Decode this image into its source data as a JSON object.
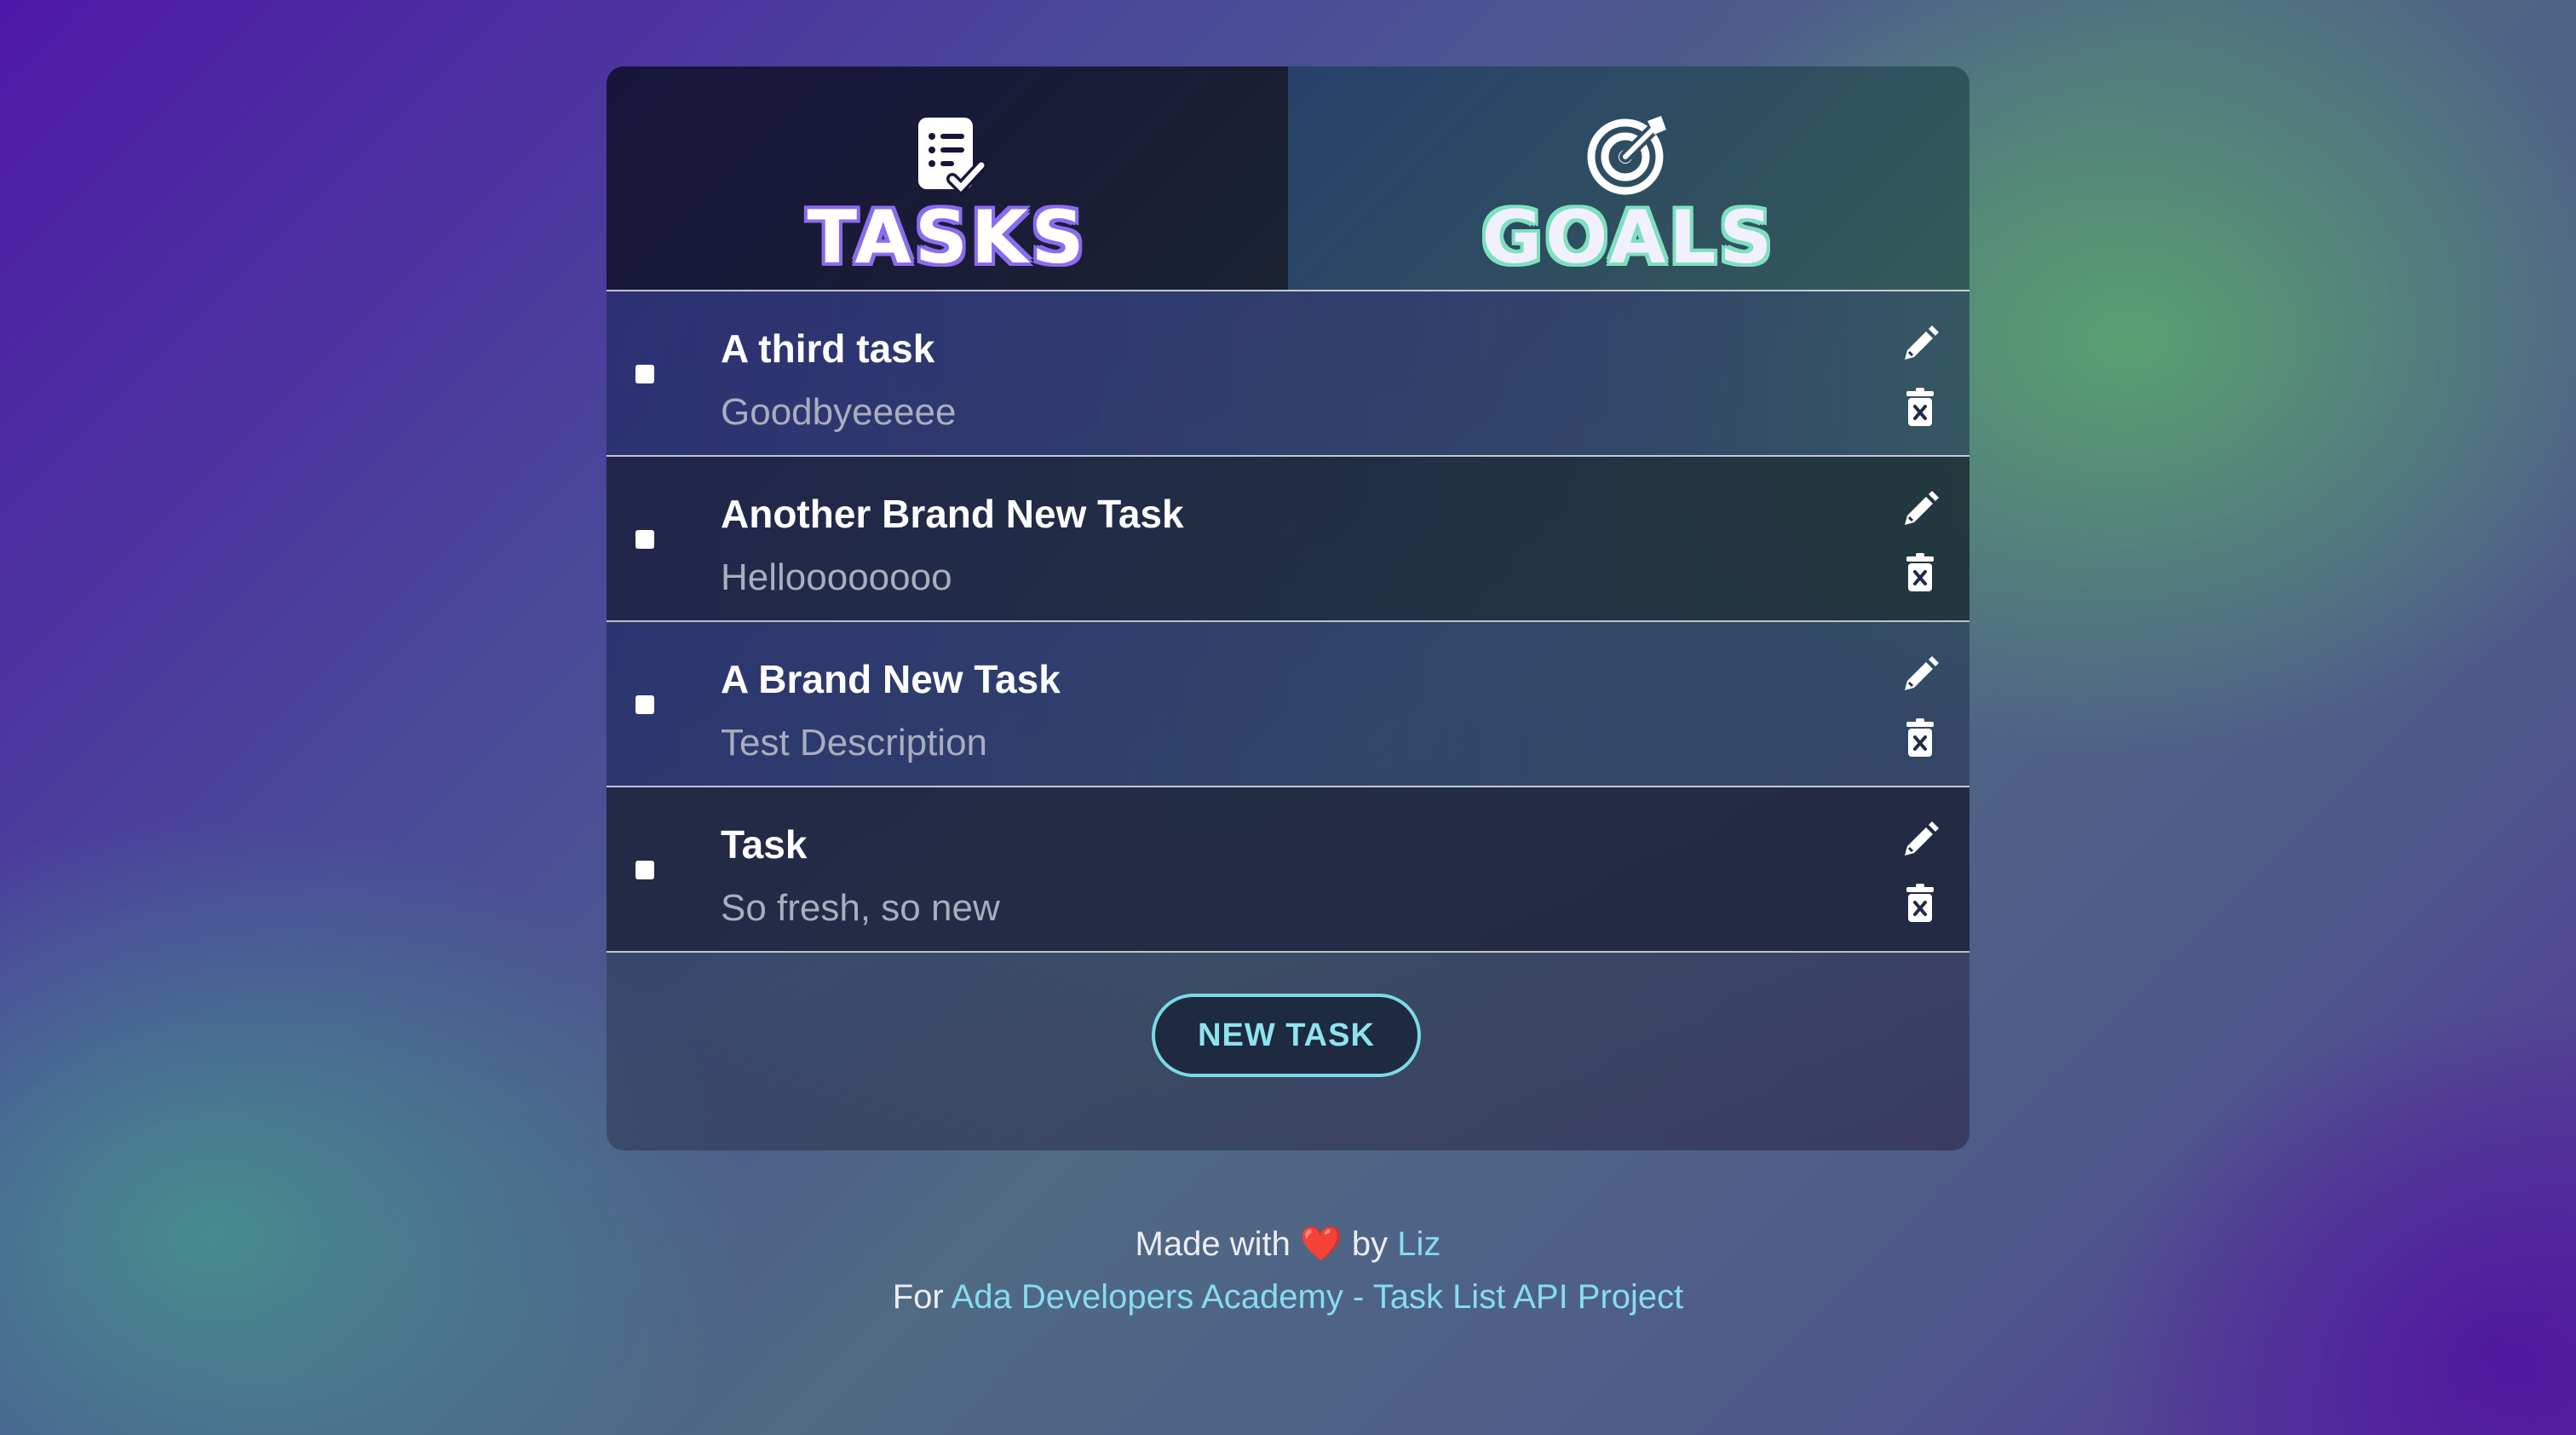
{
  "tabs": [
    {
      "label": "TASKS",
      "icon": "clipboard-check-icon",
      "active": true
    },
    {
      "label": "GOALS",
      "icon": "target-arrow-icon",
      "active": false
    }
  ],
  "tasks": [
    {
      "title": "A third task",
      "description": "Goodbyeeeee",
      "completed": false
    },
    {
      "title": "Another Brand New Task",
      "description": "Helloooooooo",
      "completed": false
    },
    {
      "title": "A Brand New Task",
      "description": "Test Description",
      "completed": false
    },
    {
      "title": "Task",
      "description": "So fresh, so new",
      "completed": false
    }
  ],
  "new_task_label": "NEW TASK",
  "footer": {
    "made_with": "Made with",
    "heart": "❤️",
    "by": "by",
    "author": "Liz",
    "for": "For",
    "org": "Ada Developers Academy",
    "separator": " - ",
    "project": "Task List API Project"
  },
  "colors": {
    "accent": "#7cd9e8",
    "tasks_outline": "#8a6cf0",
    "goals_outline": "#7fe0c0"
  }
}
